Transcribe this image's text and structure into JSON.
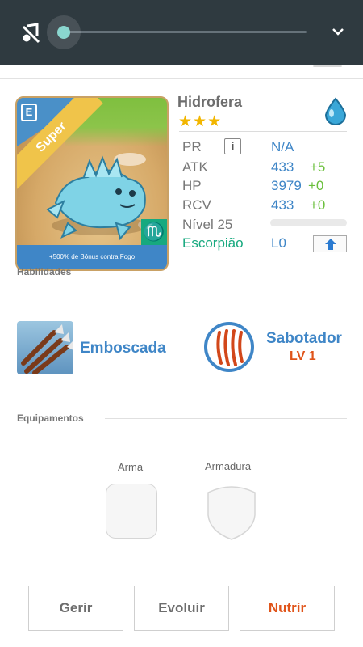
{
  "media_bar": {
    "icons": [
      "mute-icon",
      "chevron-down-icon"
    ],
    "volume": 0.0,
    "colors": {
      "bar": "#2f3a40",
      "thumb": "#8ad6cf"
    }
  },
  "card": {
    "ribbon": "Super",
    "element_badge": "E",
    "bonus_text": "+500% de Bônus contra Fogo",
    "zodiac_symbol": "♏"
  },
  "monster": {
    "name": "Hidrofera",
    "rarity_stars": 3,
    "stars_text": "★★★",
    "element_icon": "water-drop-icon",
    "stats": {
      "pr": {
        "label": "PR",
        "value": "N/A"
      },
      "atk": {
        "label": "ATK",
        "value": "433",
        "bonus": "+5"
      },
      "hp": {
        "label": "HP",
        "value": "3979",
        "bonus": "+0"
      },
      "rcv": {
        "label": "RCV",
        "value": "433",
        "bonus": "+0"
      }
    },
    "level_text": "Nível 25",
    "level_progress": 0.0,
    "zodiac": "Escorpião",
    "rank": "L0"
  },
  "sections": {
    "abilities": "Habilidades",
    "equipment": "Equipamentos"
  },
  "abilities": {
    "active": {
      "name": "Emboscada",
      "icon": "arrows-skill-icon"
    },
    "passive": {
      "name": "Sabotador",
      "level": "LV 1",
      "icon": "claw-marks-icon"
    }
  },
  "equipment": {
    "weapon": "Arma",
    "armor": "Armadura"
  },
  "actions": {
    "manage": "Gerir",
    "evolve": "Evoluir",
    "feed": "Nutrir"
  },
  "colors": {
    "accent": "#3f86c7",
    "bonus": "#6abf3b",
    "zodiac": "#17a97f",
    "feed": "#e0541a",
    "stars": "#f2b600"
  }
}
